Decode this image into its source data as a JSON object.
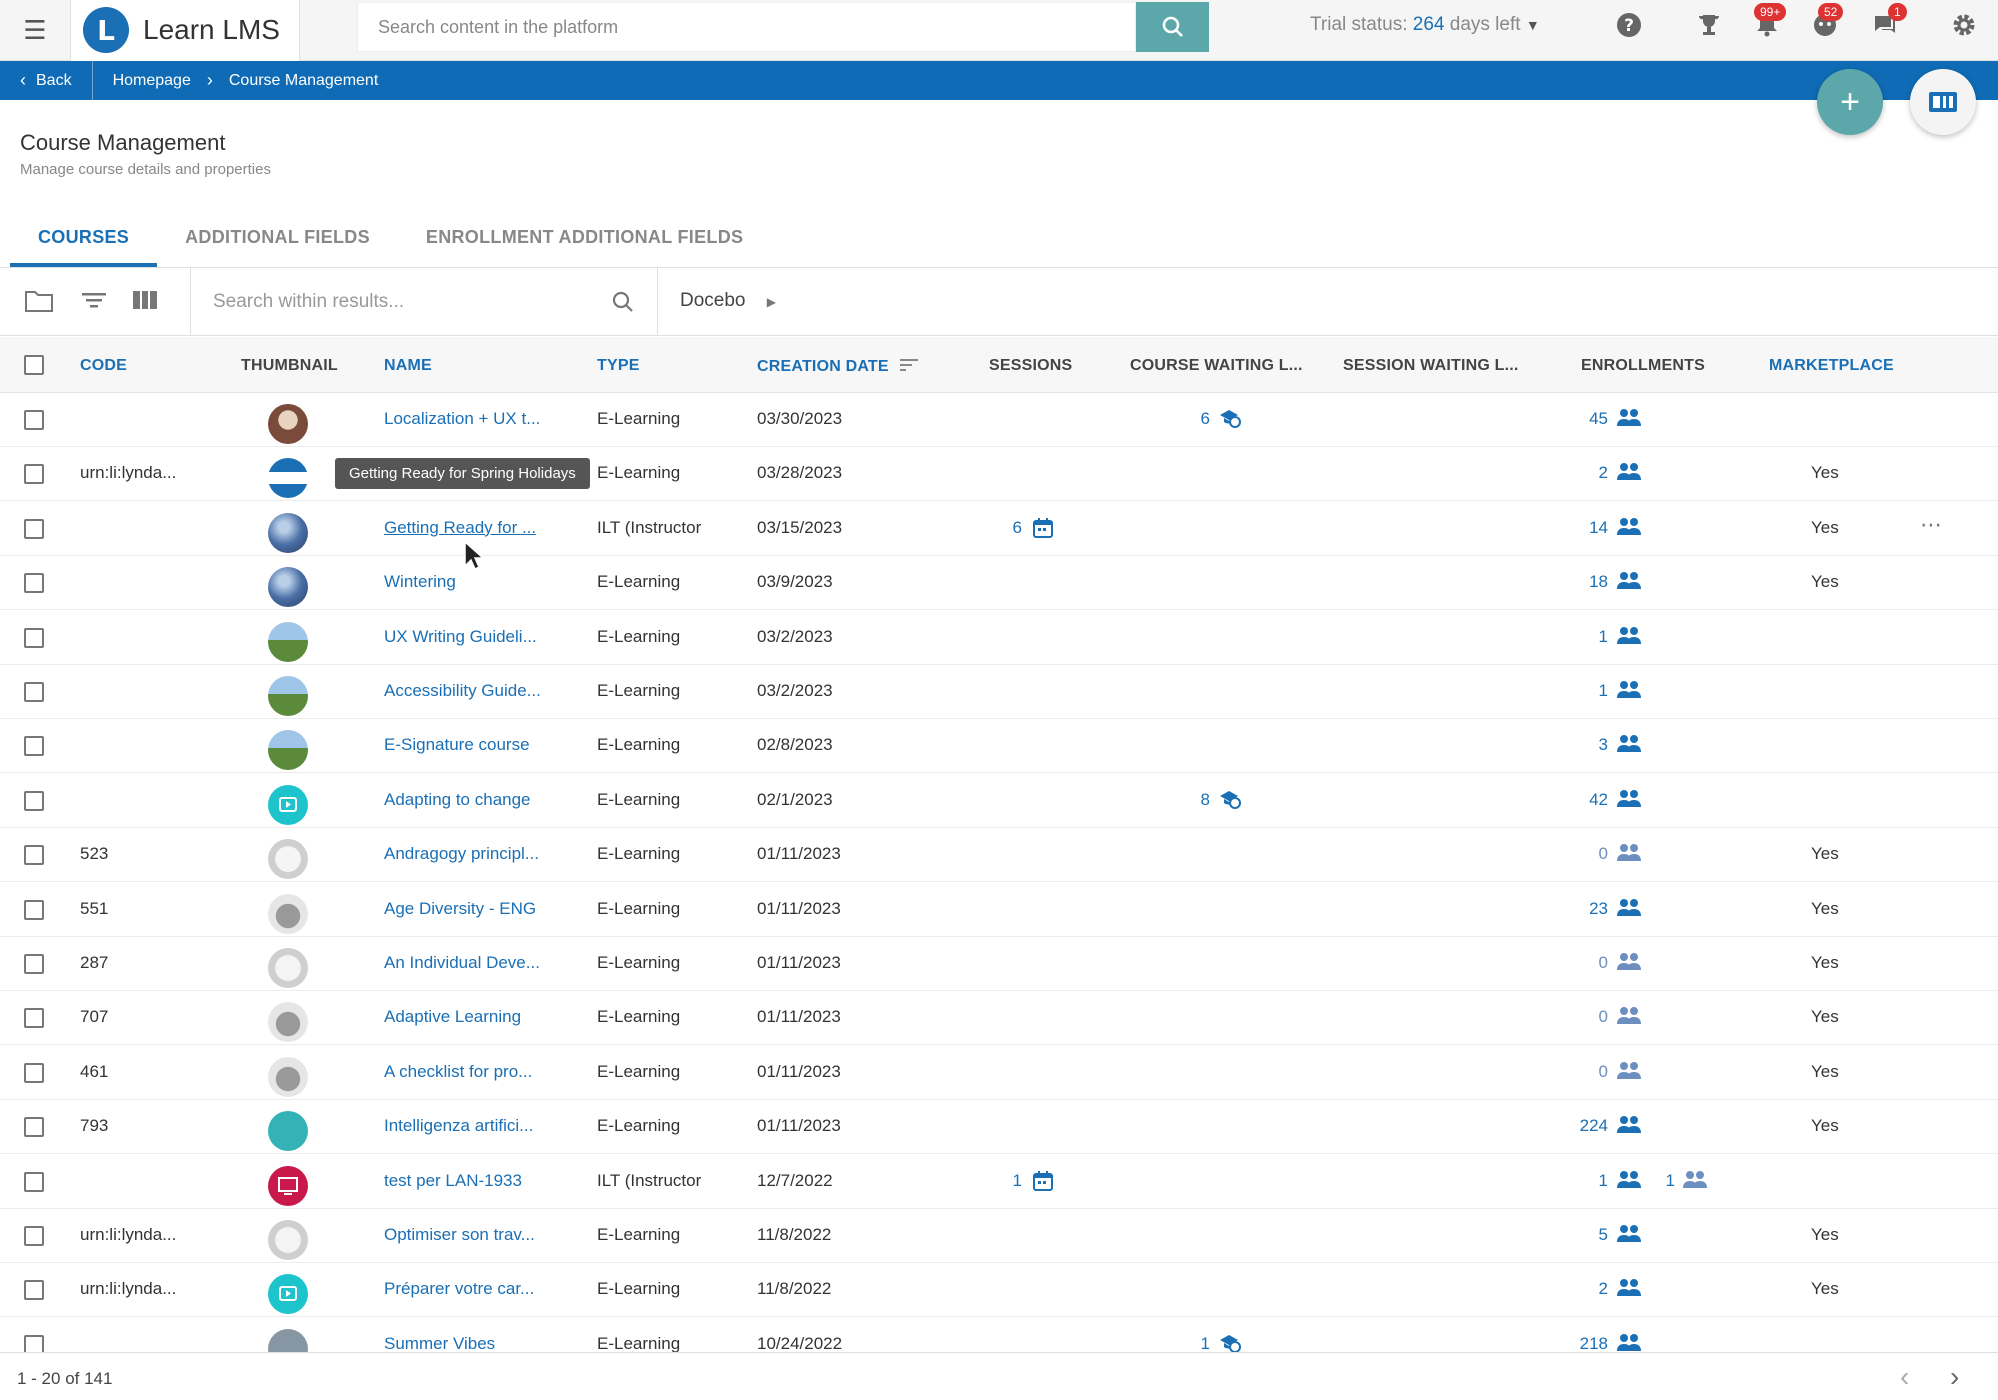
{
  "app": {
    "name": "Learn LMS",
    "logo_letter": "L"
  },
  "search": {
    "placeholder": "Search content in the platform"
  },
  "trial": {
    "label": "Trial status:",
    "days": "264",
    "suffix": "days left"
  },
  "badges": {
    "notifications": "99+",
    "gamification": "52",
    "messages": "1"
  },
  "breadcrumb": {
    "back": "Back",
    "items": [
      "Homepage",
      "Course Management"
    ]
  },
  "page": {
    "title": "Course Management",
    "subtitle": "Manage course details and properties"
  },
  "tabs": [
    {
      "label": "COURSES",
      "active": true
    },
    {
      "label": "ADDITIONAL FIELDS",
      "active": false
    },
    {
      "label": "ENROLLMENT ADDITIONAL FIELDS",
      "active": false
    }
  ],
  "filter": {
    "search_placeholder": "Search within results...",
    "branch": "Docebo"
  },
  "columns": {
    "code": "CODE",
    "thumbnail": "THUMBNAIL",
    "name": "NAME",
    "type": "TYPE",
    "creation_date": "CREATION DATE",
    "sessions": "SESSIONS",
    "course_waiting": "COURSE WAITING L...",
    "session_waiting": "SESSION WAITING L...",
    "enrollments": "ENROLLMENTS",
    "marketplace": "MARKETPLACE"
  },
  "tooltip": "Getting Ready for Spring Holidays",
  "rows": [
    {
      "code": "",
      "name": "Localization + UX t...",
      "type": "E-Learning",
      "date": "03/30/2023",
      "sessions": "",
      "waiting": "6",
      "session_waiting": "",
      "enrollments": "45",
      "marketplace": "",
      "thumb": "photo-room"
    },
    {
      "code": "urn:li:lynda...",
      "name": "",
      "type": "E-Learning",
      "date": "03/28/2023",
      "sessions": "",
      "waiting": "",
      "session_waiting": "",
      "enrollments": "2",
      "marketplace": "Yes",
      "thumb": "banner"
    },
    {
      "code": "",
      "name": "Getting Ready for ...",
      "type": "ILT (Instructor",
      "date": "03/15/2023",
      "sessions": "6",
      "waiting": "",
      "session_waiting": "",
      "enrollments": "14",
      "marketplace": "Yes",
      "thumb": "globe"
    },
    {
      "code": "",
      "name": "Wintering",
      "type": "E-Learning",
      "date": "03/9/2023",
      "sessions": "",
      "waiting": "",
      "session_waiting": "",
      "enrollments": "18",
      "marketplace": "Yes",
      "thumb": "globe"
    },
    {
      "code": "",
      "name": "UX Writing Guideli...",
      "type": "E-Learning",
      "date": "03/2/2023",
      "sessions": "",
      "waiting": "",
      "session_waiting": "",
      "enrollments": "1",
      "marketplace": "",
      "thumb": "landscape"
    },
    {
      "code": "",
      "name": "Accessibility Guide...",
      "type": "E-Learning",
      "date": "03/2/2023",
      "sessions": "",
      "waiting": "",
      "session_waiting": "",
      "enrollments": "1",
      "marketplace": "",
      "thumb": "landscape"
    },
    {
      "code": "",
      "name": "E-Signature course",
      "type": "E-Learning",
      "date": "02/8/2023",
      "sessions": "",
      "waiting": "",
      "session_waiting": "",
      "enrollments": "3",
      "marketplace": "",
      "thumb": "landscape"
    },
    {
      "code": "",
      "name": "Adapting to change",
      "type": "E-Learning",
      "date": "02/1/2023",
      "sessions": "",
      "waiting": "8",
      "session_waiting": "",
      "enrollments": "42",
      "marketplace": "",
      "thumb": "play-teal"
    },
    {
      "code": "523",
      "name": "Andragogy principl...",
      "type": "E-Learning",
      "date": "01/11/2023",
      "sessions": "",
      "waiting": "",
      "session_waiting": "",
      "enrollments": "0",
      "marketplace": "Yes",
      "thumb": "illustration"
    },
    {
      "code": "551",
      "name": "Age Diversity - ENG",
      "type": "E-Learning",
      "date": "01/11/2023",
      "sessions": "",
      "waiting": "",
      "session_waiting": "",
      "enrollments": "23",
      "marketplace": "Yes",
      "thumb": "illustration-gray"
    },
    {
      "code": "287",
      "name": "An Individual Deve...",
      "type": "E-Learning",
      "date": "01/11/2023",
      "sessions": "",
      "waiting": "",
      "session_waiting": "",
      "enrollments": "0",
      "marketplace": "Yes",
      "thumb": "illustration"
    },
    {
      "code": "707",
      "name": "Adaptive Learning",
      "type": "E-Learning",
      "date": "01/11/2023",
      "sessions": "",
      "waiting": "",
      "session_waiting": "",
      "enrollments": "0",
      "marketplace": "Yes",
      "thumb": "illustration-gray"
    },
    {
      "code": "461",
      "name": "A checklist for pro...",
      "type": "E-Learning",
      "date": "01/11/2023",
      "sessions": "",
      "waiting": "",
      "session_waiting": "",
      "enrollments": "0",
      "marketplace": "Yes",
      "thumb": "illustration-gray"
    },
    {
      "code": "793",
      "name": "Intelligenza artifici...",
      "type": "E-Learning",
      "date": "01/11/2023",
      "sessions": "",
      "waiting": "",
      "session_waiting": "",
      "enrollments": "224",
      "marketplace": "Yes",
      "thumb": "teal-text"
    },
    {
      "code": "",
      "name": "test per LAN-1933",
      "type": "ILT (Instructor",
      "date": "12/7/2022",
      "sessions": "1",
      "waiting": "",
      "session_waiting": "1",
      "enrollments": "1",
      "marketplace": "",
      "thumb": "monitor-red"
    },
    {
      "code": "urn:li:lynda...",
      "name": "Optimiser son trav...",
      "type": "E-Learning",
      "date": "11/8/2022",
      "sessions": "",
      "waiting": "",
      "session_waiting": "",
      "enrollments": "5",
      "marketplace": "Yes",
      "thumb": "illustration"
    },
    {
      "code": "urn:li:lynda...",
      "name": "Préparer votre car...",
      "type": "E-Learning",
      "date": "11/8/2022",
      "sessions": "",
      "waiting": "",
      "session_waiting": "",
      "enrollments": "2",
      "marketplace": "Yes",
      "thumb": "play-teal"
    },
    {
      "code": "",
      "name": "Summer Vibes",
      "type": "E-Learning",
      "date": "10/24/2022",
      "sessions": "",
      "waiting": "1",
      "session_waiting": "",
      "enrollments": "218",
      "marketplace": "",
      "thumb": "gray"
    }
  ],
  "pagination": {
    "label": "1 - 20 of 141"
  },
  "colors": {
    "primary": "#1a6fb5",
    "teal": "#5ba7a9",
    "badge": "#d33333"
  }
}
